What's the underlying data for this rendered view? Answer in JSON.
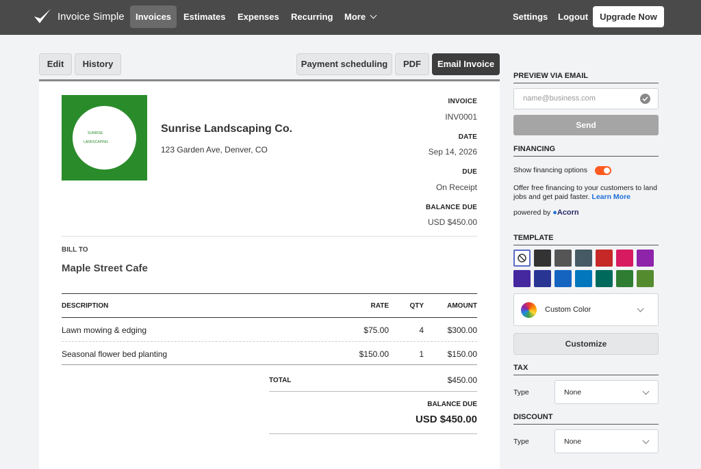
{
  "nav": {
    "brand": "Invoice Simple",
    "links": [
      "Invoices",
      "Estimates",
      "Expenses",
      "Recurring",
      "More"
    ],
    "settings": "Settings",
    "logout": "Logout",
    "upgrade": "Upgrade Now"
  },
  "tabs": {
    "edit": "Edit",
    "history": "History",
    "payment_scheduling": "Payment scheduling",
    "pdf": "PDF",
    "email_invoice": "Email Invoice"
  },
  "invoice": {
    "logo_line1": "SUNRISE",
    "logo_line2": "LANDSCAPING",
    "company": "Sunrise Landscaping Co.",
    "address": "123 Garden Ave, Denver, CO",
    "invoice_label": "INVOICE",
    "invoice_number": "INV0001",
    "date_label": "DATE",
    "date": "Sep 14, 2026",
    "due_label": "DUE",
    "due": "On Receipt",
    "balance_label": "BALANCE DUE",
    "balance": "USD $450.00",
    "bill_to_label": "BILL TO",
    "bill_to": "Maple Street Cafe",
    "columns": {
      "description": "DESCRIPTION",
      "rate": "RATE",
      "qty": "QTY",
      "amount": "AMOUNT"
    },
    "items": [
      {
        "description": "Lawn mowing & edging",
        "rate": "$75.00",
        "qty": "4",
        "amount": "$300.00"
      },
      {
        "description": "Seasonal flower bed planting",
        "rate": "$150.00",
        "qty": "1",
        "amount": "$150.00"
      }
    ],
    "total_label": "TOTAL",
    "total": "$450.00",
    "balance_due_label": "BALANCE DUE",
    "balance_due": "USD $450.00"
  },
  "sidebar": {
    "preview_title": "PREVIEW VIA EMAIL",
    "email_placeholder": "name@business.com",
    "send": "Send",
    "financing_title": "FINANCING",
    "financing_toggle_label": "Show financing options",
    "financing_on": true,
    "financing_desc": "Offer free financing to your customers to land jobs and get paid faster.",
    "learn_more": "Learn More",
    "powered_by": "powered by",
    "acorn": "Acorn",
    "template_title": "TEMPLATE",
    "colors": [
      "#333333",
      "#555555",
      "#455a64",
      "#c62828",
      "#d81b60",
      "#8e24aa",
      "#4527a0",
      "#283593",
      "#1565c0",
      "#0277bd",
      "#00695c",
      "#2e7d32",
      "#558b2f"
    ],
    "custom_color": "Custom Color",
    "customize": "Customize",
    "tax_title": "TAX",
    "tax_type_label": "Type",
    "tax_type": "None",
    "discount_title": "DISCOUNT",
    "discount_type_label": "Type",
    "discount_type": "None"
  }
}
